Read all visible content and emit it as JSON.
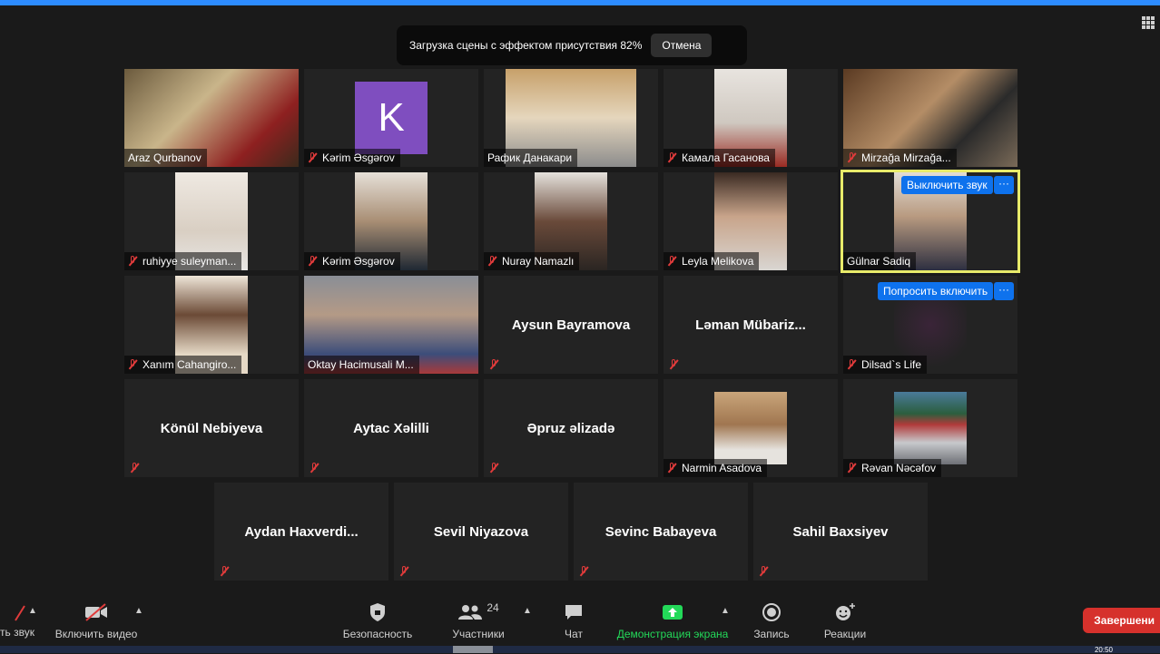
{
  "banner": {
    "text": "Загрузка сцены с эффектом присутствия 82%",
    "cancel": "Отмена"
  },
  "tiles": [
    {
      "name": "Araz  Qurbanov",
      "muted": false,
      "type": "video"
    },
    {
      "name": "Kərim Əsgərov",
      "muted": true,
      "type": "avatar",
      "initial": "K"
    },
    {
      "name": "Рафик Данакари",
      "muted": false,
      "type": "video"
    },
    {
      "name": "Камала Гасанова",
      "muted": true,
      "type": "video"
    },
    {
      "name": "Mirzağa Mirzağa...",
      "muted": true,
      "type": "video"
    },
    {
      "name": "ruhiyye suleyman...",
      "muted": true,
      "type": "video"
    },
    {
      "name": "Kərim Əsgərov",
      "muted": true,
      "type": "video"
    },
    {
      "name": "Nuray Namazlı",
      "muted": true,
      "type": "video"
    },
    {
      "name": "Leyla Melikova",
      "muted": true,
      "type": "video"
    },
    {
      "name": "Gülnar Sadiq",
      "muted": false,
      "type": "video",
      "active": true,
      "button": "Выключить звук"
    },
    {
      "name": "Xanım Cahangiro...",
      "muted": true,
      "type": "video"
    },
    {
      "name": "Oktay Hacimusali M...",
      "muted": false,
      "type": "video"
    },
    {
      "name": "Aysun Bayramova",
      "muted": true,
      "type": "name"
    },
    {
      "name": "Ləman  Mübariz...",
      "muted": true,
      "type": "name"
    },
    {
      "name": "Dilsad`s Life",
      "muted": true,
      "type": "video",
      "button": "Попросить включить"
    },
    {
      "name": "Könül Nebiyeva",
      "muted": true,
      "type": "name"
    },
    {
      "name": "Aytac Xəlilli",
      "muted": true,
      "type": "name"
    },
    {
      "name": "Əpruz əlizadə",
      "muted": true,
      "type": "name"
    },
    {
      "name": "Narmin Asadova",
      "muted": true,
      "type": "video"
    },
    {
      "name": "Rəvan Nəcəfov",
      "muted": true,
      "type": "video"
    },
    {
      "name": "Aydan  Haxverdi...",
      "muted": true,
      "type": "name"
    },
    {
      "name": "Sevil Niyazova",
      "muted": true,
      "type": "name"
    },
    {
      "name": "Sevinc Babayeva",
      "muted": true,
      "type": "name"
    },
    {
      "name": "Sahil Baxsiyev",
      "muted": true,
      "type": "name"
    }
  ],
  "more_label": "···",
  "toolbar": {
    "audio": "ть звук",
    "video": "Включить видео",
    "security": "Безопасность",
    "participants": "Участники",
    "participants_count": "24",
    "chat": "Чат",
    "share": "Демонстрация экрана",
    "record": "Запись",
    "reactions": "Реакции",
    "end": "Завершени"
  },
  "clock": "20:50",
  "colors": {
    "accent": "#0e72ed",
    "share_green": "#23d959",
    "end_red": "#d6312c",
    "active_border": "#e8eb6a",
    "avatar_purple": "#7f4ebf"
  }
}
